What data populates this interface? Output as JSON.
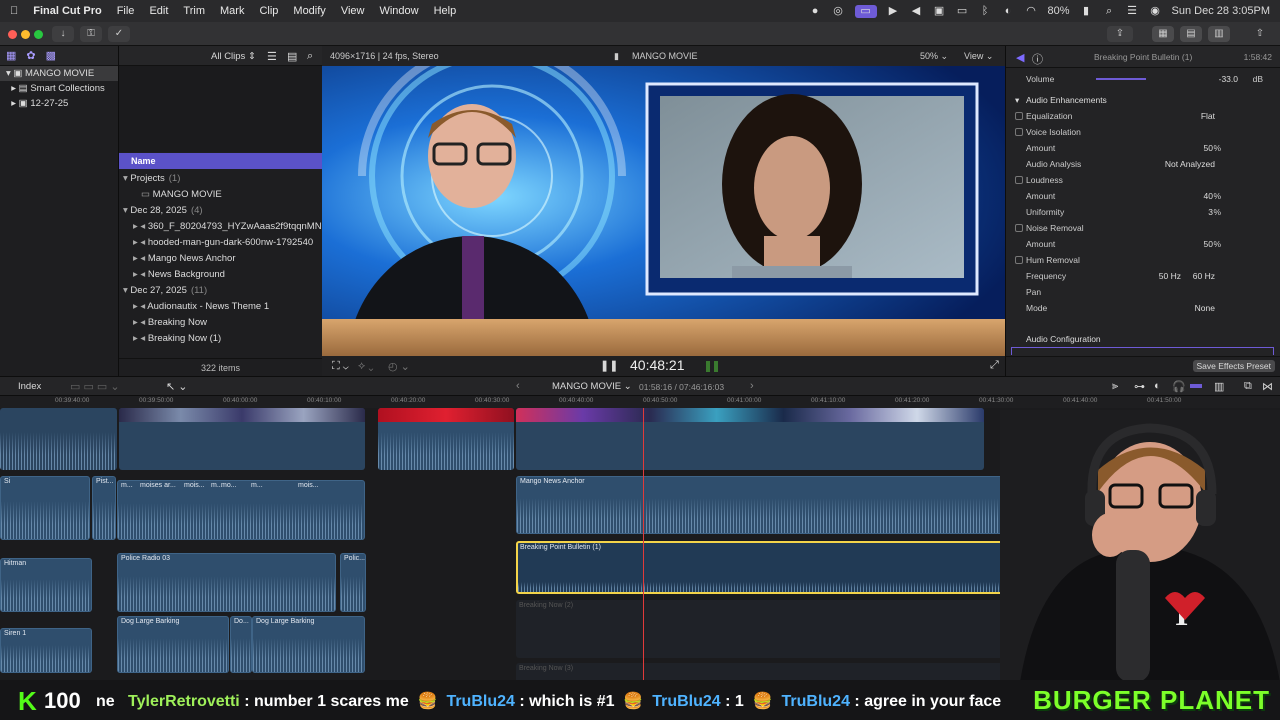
{
  "menubar": {
    "app": "Final Cut Pro",
    "items": [
      "File",
      "Edit",
      "Trim",
      "Mark",
      "Clip",
      "Modify",
      "View",
      "Window",
      "Help"
    ],
    "battery": "80%",
    "datetime": "Sun Dec 28  3:05PM"
  },
  "library": {
    "root": "MANGO MOVIE",
    "items": [
      "Smart Collections",
      "12-27-25"
    ]
  },
  "browser": {
    "filter": "All Clips",
    "column_name": "Name",
    "rows": [
      {
        "label": "Projects",
        "count": "(1)",
        "indent": 0,
        "type": "group"
      },
      {
        "label": "MANGO MOVIE",
        "indent": 2,
        "type": "item"
      },
      {
        "label": "Dec 28, 2025",
        "count": "(4)",
        "indent": 0,
        "type": "group"
      },
      {
        "label": "360_F_80204793_HYZwAaas2f9tqqnMN",
        "indent": 1,
        "type": "item"
      },
      {
        "label": "hooded-man-gun-dark-600nw-1792540",
        "indent": 1,
        "type": "item"
      },
      {
        "label": "Mango News Anchor",
        "indent": 1,
        "type": "item"
      },
      {
        "label": "News Background",
        "indent": 1,
        "type": "item"
      },
      {
        "label": "Dec 27, 2025",
        "count": "(11)",
        "indent": 0,
        "type": "group"
      },
      {
        "label": "Audionautix - News Theme 1",
        "indent": 1,
        "type": "item"
      },
      {
        "label": "Breaking Now",
        "indent": 1,
        "type": "item"
      },
      {
        "label": "Breaking Now (1)",
        "indent": 1,
        "type": "item"
      }
    ],
    "item_count": "322 items"
  },
  "viewer": {
    "format": "4096×1716 | 24 fps, Stereo",
    "title": "MANGO MOVIE",
    "zoom": "50%",
    "view_label": "View",
    "timecode": "40:48:21"
  },
  "inspector": {
    "clip_title": "Breaking Point Bulletin (1)",
    "duration": "1:58:42",
    "volume_label": "Volume",
    "volume_value": "-33.0",
    "volume_unit": "dB",
    "section_enh": "Audio Enhancements",
    "rows": [
      {
        "label": "Equalization",
        "value": "Flat",
        "check": true
      },
      {
        "label": "Voice Isolation",
        "check": true
      },
      {
        "label": "Amount",
        "value": "50",
        "unit": "%"
      },
      {
        "label": "Audio Analysis",
        "value": "Not Analyzed"
      },
      {
        "label": "Loudness",
        "check": true
      },
      {
        "label": "Amount",
        "value": "40",
        "unit": "%"
      },
      {
        "label": "Uniformity",
        "value": "3",
        "unit": "%"
      },
      {
        "label": "Noise Removal",
        "check": true
      },
      {
        "label": "Amount",
        "value": "50",
        "unit": "%"
      },
      {
        "label": "Hum Removal",
        "check": true
      },
      {
        "label": "Frequency",
        "value": "50 Hz",
        "value2": "60 Hz"
      },
      {
        "label": "Pan"
      },
      {
        "label": "Mode",
        "value": "None"
      }
    ],
    "audio_config": "Audio Configuration",
    "save_preset": "Save Effects Preset"
  },
  "timeline": {
    "index_label": "Index",
    "project": "MANGO MOVIE",
    "position": "01:58:16 / 07:46:16:03",
    "ruler": [
      "00:39:40:00",
      "00:39:50:00",
      "00:40:00:00",
      "00:40:10:00",
      "00:40:20:00",
      "00:40:30:00",
      "00:40:40:00",
      "00:40:50:00",
      "00:41:00:00",
      "00:41:10:00",
      "00:41:20:00",
      "00:41:30:00",
      "00:41:40:00",
      "00:41:50:00"
    ],
    "clips": {
      "anchor": "Mango News Anchor",
      "bulletin": "Breaking Point Bulletin (1)",
      "breaking2": "Breaking Now (2)",
      "breaking3": "Breaking Now (3)",
      "police": "Police Radio 03",
      "police2": "Polic...",
      "hitman": "Hitman",
      "siren": "Siren 1",
      "dog1": "Dog Large Barking",
      "dog_mid": "Do...",
      "dog2": "Dog Large Barking",
      "moises": [
        "m...",
        "moises ar...",
        "mois...",
        "m...",
        "mo...",
        "m...",
        "mois..."
      ],
      "pist": "Pist...",
      "si": "Si"
    }
  },
  "ticker": {
    "k": "K",
    "count": "100",
    "messages": [
      {
        "user": "ne",
        "text": ""
      },
      {
        "user": "TylerRetrovetti",
        "text": ": number 1 scares me"
      },
      {
        "user": "TruBlu24",
        "text": ": which is #1"
      },
      {
        "user": "TruBlu24",
        "text": ": 1"
      },
      {
        "user": "TruBlu24",
        "text": ": agree in your face"
      }
    ],
    "brand": "BURGER PLANET"
  }
}
